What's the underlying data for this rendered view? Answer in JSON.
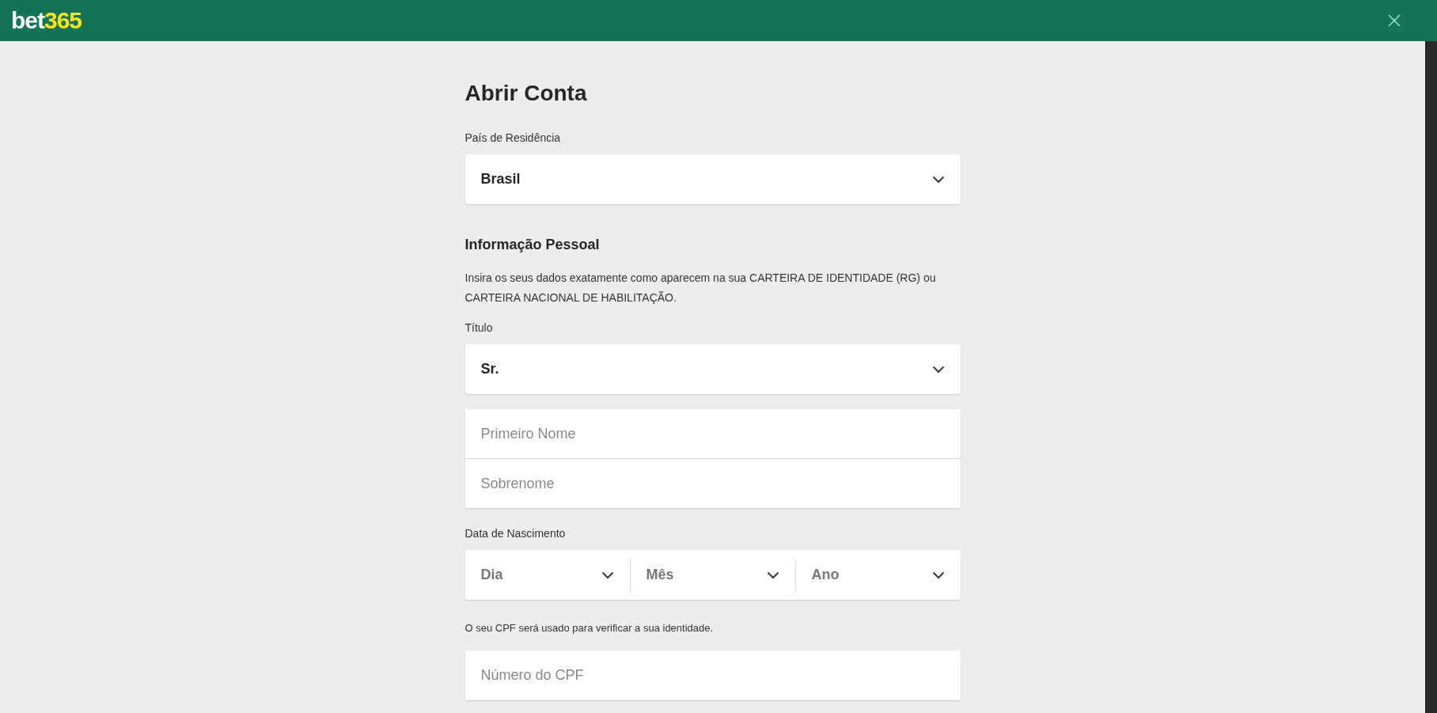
{
  "header": {
    "logo": {
      "part_1": "bet",
      "part_2": "365"
    }
  },
  "title": "Abrir Conta",
  "country": {
    "label": "País de Residência",
    "value": "Brasil"
  },
  "personal": {
    "heading": "Informação Pessoal",
    "intro": "Insira os seus dados exatamente como aparecem na sua CARTEIRA DE IDENTIDADE (RG) ou CARTEIRA NACIONAL DE HABILITAÇÃO."
  },
  "title_select": {
    "label": "Título",
    "value": "Sr."
  },
  "name_fields": [
    {
      "placeholder": "Primeiro Nome"
    },
    {
      "placeholder": "Sobrenome"
    }
  ],
  "birth_date": {
    "label": "Data de Nascimento",
    "selects": [
      {
        "placeholder": "Dia"
      },
      {
        "placeholder": "Mês"
      },
      {
        "placeholder": "Ano"
      }
    ]
  },
  "cpf": {
    "note": "O seu CPF será usado para verificar a sua identidade.",
    "placeholder": "Número do CPF"
  }
}
